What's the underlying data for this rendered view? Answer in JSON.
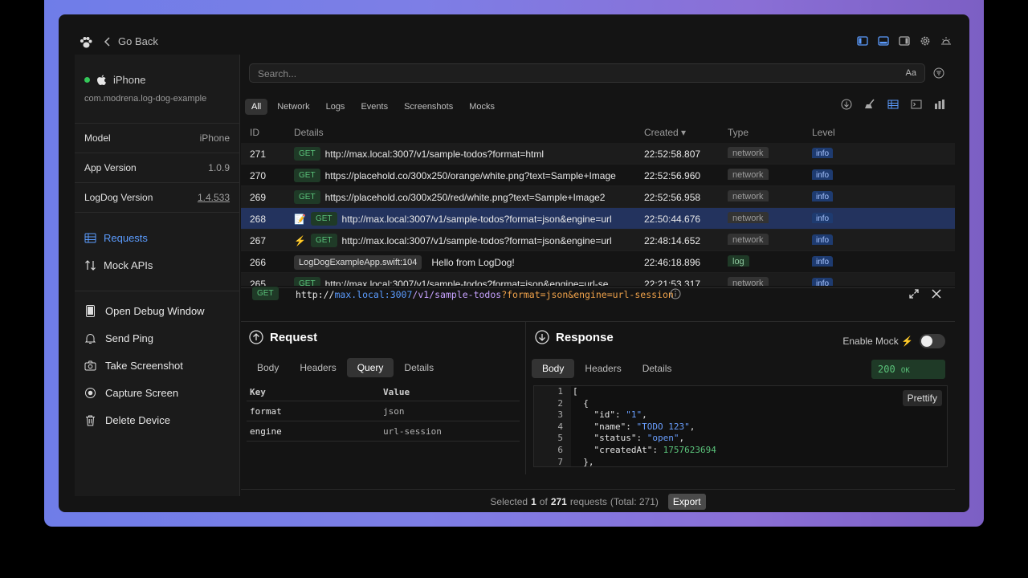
{
  "colors": {
    "accent": "#5b9cff",
    "selected_row": "#23335e",
    "method_green": "#5ac27a",
    "online": "#34c759"
  },
  "titlebar": {
    "back_label": "Go Back"
  },
  "sidebar": {
    "device_name": "iPhone",
    "bundle_id": "com.modrena.log-dog-example",
    "info": [
      {
        "key": "Model",
        "value": "iPhone"
      },
      {
        "key": "App Version",
        "value": "1.0.9"
      },
      {
        "key": "LogDog Version",
        "value": "1.4.533"
      }
    ],
    "nav": [
      {
        "label": "Requests",
        "icon": "table-icon",
        "active": true
      },
      {
        "label": "Mock APIs",
        "icon": "arrows-up-down-icon"
      }
    ],
    "actions": [
      {
        "label": "Open Debug Window",
        "icon": "phone-window-icon"
      },
      {
        "label": "Send Ping",
        "icon": "bell-icon"
      },
      {
        "label": "Take Screenshot",
        "icon": "camera-icon"
      },
      {
        "label": "Capture Screen",
        "icon": "record-icon"
      },
      {
        "label": "Delete Device",
        "icon": "trash-icon"
      }
    ]
  },
  "search": {
    "placeholder": "Search...",
    "case_label": "Aa"
  },
  "filters": [
    "All",
    "Network",
    "Logs",
    "Events",
    "Screenshots",
    "Mocks"
  ],
  "table": {
    "headers": {
      "id": "ID",
      "details": "Details",
      "created": "Created ▾",
      "type": "Type",
      "level": "Level"
    },
    "rows": [
      {
        "id": "271",
        "badge": "",
        "method": "GET",
        "text": "http://max.local:3007/v1/sample-todos?format=html",
        "created": "22:52:58.807",
        "type": "network",
        "level": "info"
      },
      {
        "id": "270",
        "badge": "",
        "method": "GET",
        "text": "https://placehold.co/300x250/orange/white.png?text=Sample+Image",
        "created": "22:52:56.960",
        "type": "network",
        "level": "info"
      },
      {
        "id": "269",
        "badge": "",
        "method": "GET",
        "text": "https://placehold.co/300x250/red/white.png?text=Sample+Image2",
        "created": "22:52:56.958",
        "type": "network",
        "level": "info"
      },
      {
        "id": "268",
        "badge": "📝",
        "method": "GET",
        "text": "http://max.local:3007/v1/sample-todos?format=json&engine=url",
        "created": "22:50:44.676",
        "type": "network",
        "level": "info"
      },
      {
        "id": "267",
        "badge": "⚡",
        "method": "GET",
        "text": "http://max.local:3007/v1/sample-todos?format=json&engine=url",
        "created": "22:48:14.652",
        "type": "network",
        "level": "info"
      },
      {
        "id": "266",
        "badge": "",
        "file": "LogDogExampleApp.swift:104",
        "text": "Hello from LogDog!",
        "created": "22:46:18.896",
        "type": "log",
        "level": "info"
      },
      {
        "id": "265",
        "badge": "",
        "method": "GET",
        "text": "http://max.local:3007/v1/sample-todos?format=json&engine=url-se",
        "created": "22:21:53.317",
        "type": "network",
        "level": "info"
      }
    ]
  },
  "detail": {
    "method": "GET",
    "url_scheme": "http://",
    "url_host": "max.local:3007",
    "url_path": "/v1/sample-todos",
    "url_query": "?format=json&engine=url-session",
    "request": {
      "title": "Request",
      "tabs": [
        "Body",
        "Headers",
        "Query",
        "Details"
      ],
      "query_headers": {
        "key": "Key",
        "value": "Value"
      },
      "query": [
        {
          "key": "format",
          "value": "json"
        },
        {
          "key": "engine",
          "value": "url-session"
        }
      ]
    },
    "response": {
      "title": "Response",
      "enable_mock": "Enable Mock ⚡",
      "tabs": [
        "Body",
        "Headers",
        "Details"
      ],
      "status_code": "200",
      "status_text": "OK",
      "prettify": "Prettify",
      "lines": [
        "1",
        "2",
        "3",
        "4",
        "5",
        "6",
        "7"
      ]
    }
  },
  "footer": {
    "prefix": "Selected",
    "selected": "1",
    "of": "of",
    "total_count": "271",
    "suffix": "requests",
    "total_label": "(Total: 271)",
    "export": "Export"
  }
}
